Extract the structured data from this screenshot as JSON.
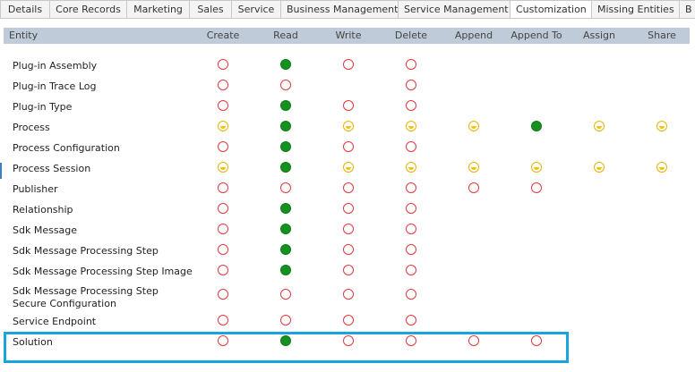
{
  "tabs": [
    {
      "label": "Details",
      "active": false
    },
    {
      "label": "Core Records",
      "active": false
    },
    {
      "label": "Marketing",
      "active": false
    },
    {
      "label": "Sales",
      "active": false
    },
    {
      "label": "Service",
      "active": false
    },
    {
      "label": "Business Management",
      "active": false
    },
    {
      "label": "Service Management",
      "active": false
    },
    {
      "label": "Customization",
      "active": true
    },
    {
      "label": "Missing Entities",
      "active": false
    },
    {
      "label": "B",
      "active": false
    }
  ],
  "columns": {
    "entity": "Entity",
    "create": "Create",
    "read": "Read",
    "write": "Write",
    "delete": "Delete",
    "append": "Append",
    "append_to": "Append To",
    "assign": "Assign",
    "share": "Share"
  },
  "privilege_colors": {
    "none": "#e0383e",
    "global": "#14911e",
    "user": "#f2c200"
  },
  "rows": [
    {
      "name": "Plug-in Assembly",
      "privileges": [
        "none",
        "global",
        "none",
        "none",
        null,
        null,
        null,
        null
      ]
    },
    {
      "name": "Plug-in Trace Log",
      "privileges": [
        "none",
        "none",
        null,
        "none",
        null,
        null,
        null,
        null
      ]
    },
    {
      "name": "Plug-in Type",
      "privileges": [
        "none",
        "global",
        "none",
        "none",
        null,
        null,
        null,
        null
      ]
    },
    {
      "name": "Process",
      "privileges": [
        "user",
        "global",
        "user",
        "user",
        "user",
        "global",
        "user",
        "user"
      ]
    },
    {
      "name": "Process Configuration",
      "privileges": [
        "none",
        "global",
        "none",
        "none",
        null,
        null,
        null,
        null
      ]
    },
    {
      "name": "Process Session",
      "privileges": [
        "user",
        "global",
        "user",
        "user",
        "user",
        "user",
        "user",
        "user"
      ]
    },
    {
      "name": "Publisher",
      "privileges": [
        "none",
        "none",
        "none",
        "none",
        "none",
        "none",
        null,
        null
      ]
    },
    {
      "name": "Relationship",
      "privileges": [
        "none",
        "global",
        "none",
        "none",
        null,
        null,
        null,
        null
      ]
    },
    {
      "name": "Sdk Message",
      "privileges": [
        "none",
        "global",
        "none",
        "none",
        null,
        null,
        null,
        null
      ]
    },
    {
      "name": "Sdk Message Processing Step",
      "privileges": [
        "none",
        "global",
        "none",
        "none",
        null,
        null,
        null,
        null
      ]
    },
    {
      "name": "Sdk Message Processing Step Image",
      "privileges": [
        "none",
        "global",
        "none",
        "none",
        null,
        null,
        null,
        null
      ]
    },
    {
      "name": "Sdk Message Processing Step Secure Configuration",
      "privileges": [
        "none",
        "none",
        "none",
        "none",
        null,
        null,
        null,
        null
      ]
    },
    {
      "name": "Service Endpoint",
      "privileges": [
        "none",
        "none",
        "none",
        "none",
        null,
        null,
        null,
        null
      ]
    },
    {
      "name": "Solution",
      "privileges": [
        "none",
        "global",
        "none",
        "none",
        "none",
        "none",
        null,
        null
      ]
    }
  ]
}
